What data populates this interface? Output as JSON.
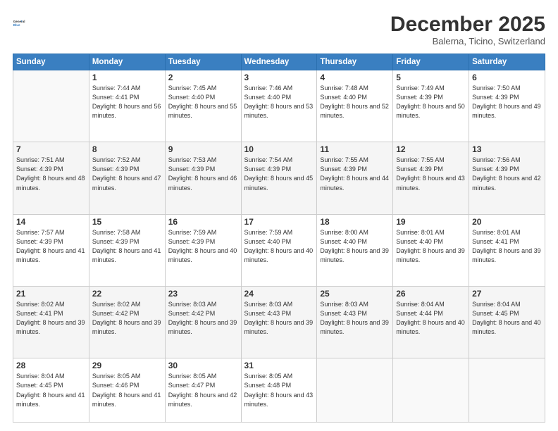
{
  "header": {
    "logo_general": "General",
    "logo_blue": "Blue",
    "month_title": "December 2025",
    "subtitle": "Balerna, Ticino, Switzerland"
  },
  "weekdays": [
    "Sunday",
    "Monday",
    "Tuesday",
    "Wednesday",
    "Thursday",
    "Friday",
    "Saturday"
  ],
  "weeks": [
    [
      {
        "day": "",
        "sunrise": "",
        "sunset": "",
        "daylight": ""
      },
      {
        "day": "1",
        "sunrise": "7:44 AM",
        "sunset": "4:41 PM",
        "daylight": "8 hours and 56 minutes."
      },
      {
        "day": "2",
        "sunrise": "7:45 AM",
        "sunset": "4:40 PM",
        "daylight": "8 hours and 55 minutes."
      },
      {
        "day": "3",
        "sunrise": "7:46 AM",
        "sunset": "4:40 PM",
        "daylight": "8 hours and 53 minutes."
      },
      {
        "day": "4",
        "sunrise": "7:48 AM",
        "sunset": "4:40 PM",
        "daylight": "8 hours and 52 minutes."
      },
      {
        "day": "5",
        "sunrise": "7:49 AM",
        "sunset": "4:39 PM",
        "daylight": "8 hours and 50 minutes."
      },
      {
        "day": "6",
        "sunrise": "7:50 AM",
        "sunset": "4:39 PM",
        "daylight": "8 hours and 49 minutes."
      }
    ],
    [
      {
        "day": "7",
        "sunrise": "7:51 AM",
        "sunset": "4:39 PM",
        "daylight": "8 hours and 48 minutes."
      },
      {
        "day": "8",
        "sunrise": "7:52 AM",
        "sunset": "4:39 PM",
        "daylight": "8 hours and 47 minutes."
      },
      {
        "day": "9",
        "sunrise": "7:53 AM",
        "sunset": "4:39 PM",
        "daylight": "8 hours and 46 minutes."
      },
      {
        "day": "10",
        "sunrise": "7:54 AM",
        "sunset": "4:39 PM",
        "daylight": "8 hours and 45 minutes."
      },
      {
        "day": "11",
        "sunrise": "7:55 AM",
        "sunset": "4:39 PM",
        "daylight": "8 hours and 44 minutes."
      },
      {
        "day": "12",
        "sunrise": "7:55 AM",
        "sunset": "4:39 PM",
        "daylight": "8 hours and 43 minutes."
      },
      {
        "day": "13",
        "sunrise": "7:56 AM",
        "sunset": "4:39 PM",
        "daylight": "8 hours and 42 minutes."
      }
    ],
    [
      {
        "day": "14",
        "sunrise": "7:57 AM",
        "sunset": "4:39 PM",
        "daylight": "8 hours and 41 minutes."
      },
      {
        "day": "15",
        "sunrise": "7:58 AM",
        "sunset": "4:39 PM",
        "daylight": "8 hours and 41 minutes."
      },
      {
        "day": "16",
        "sunrise": "7:59 AM",
        "sunset": "4:39 PM",
        "daylight": "8 hours and 40 minutes."
      },
      {
        "day": "17",
        "sunrise": "7:59 AM",
        "sunset": "4:40 PM",
        "daylight": "8 hours and 40 minutes."
      },
      {
        "day": "18",
        "sunrise": "8:00 AM",
        "sunset": "4:40 PM",
        "daylight": "8 hours and 39 minutes."
      },
      {
        "day": "19",
        "sunrise": "8:01 AM",
        "sunset": "4:40 PM",
        "daylight": "8 hours and 39 minutes."
      },
      {
        "day": "20",
        "sunrise": "8:01 AM",
        "sunset": "4:41 PM",
        "daylight": "8 hours and 39 minutes."
      }
    ],
    [
      {
        "day": "21",
        "sunrise": "8:02 AM",
        "sunset": "4:41 PM",
        "daylight": "8 hours and 39 minutes."
      },
      {
        "day": "22",
        "sunrise": "8:02 AM",
        "sunset": "4:42 PM",
        "daylight": "8 hours and 39 minutes."
      },
      {
        "day": "23",
        "sunrise": "8:03 AM",
        "sunset": "4:42 PM",
        "daylight": "8 hours and 39 minutes."
      },
      {
        "day": "24",
        "sunrise": "8:03 AM",
        "sunset": "4:43 PM",
        "daylight": "8 hours and 39 minutes."
      },
      {
        "day": "25",
        "sunrise": "8:03 AM",
        "sunset": "4:43 PM",
        "daylight": "8 hours and 39 minutes."
      },
      {
        "day": "26",
        "sunrise": "8:04 AM",
        "sunset": "4:44 PM",
        "daylight": "8 hours and 40 minutes."
      },
      {
        "day": "27",
        "sunrise": "8:04 AM",
        "sunset": "4:45 PM",
        "daylight": "8 hours and 40 minutes."
      }
    ],
    [
      {
        "day": "28",
        "sunrise": "8:04 AM",
        "sunset": "4:45 PM",
        "daylight": "8 hours and 41 minutes."
      },
      {
        "day": "29",
        "sunrise": "8:05 AM",
        "sunset": "4:46 PM",
        "daylight": "8 hours and 41 minutes."
      },
      {
        "day": "30",
        "sunrise": "8:05 AM",
        "sunset": "4:47 PM",
        "daylight": "8 hours and 42 minutes."
      },
      {
        "day": "31",
        "sunrise": "8:05 AM",
        "sunset": "4:48 PM",
        "daylight": "8 hours and 43 minutes."
      },
      {
        "day": "",
        "sunrise": "",
        "sunset": "",
        "daylight": ""
      },
      {
        "day": "",
        "sunrise": "",
        "sunset": "",
        "daylight": ""
      },
      {
        "day": "",
        "sunrise": "",
        "sunset": "",
        "daylight": ""
      }
    ]
  ]
}
